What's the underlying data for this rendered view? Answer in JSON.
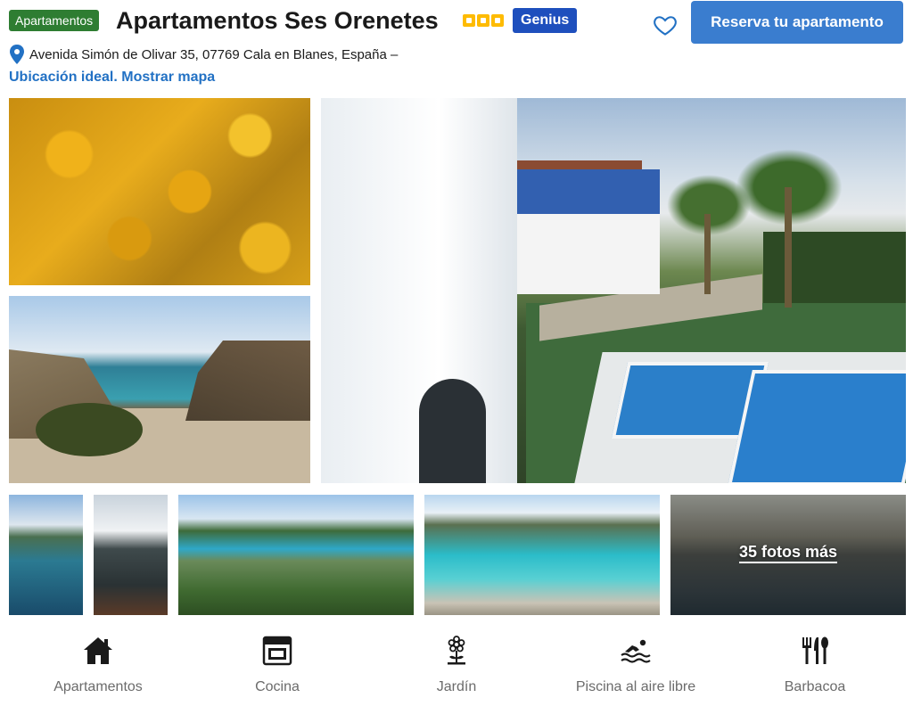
{
  "header": {
    "type_badge": "Apartamentos",
    "title": "Apartamentos Ses Orenetes",
    "star_rating": 3,
    "genius_badge": "Genius",
    "reserve_button": "Reserva tu apartamento"
  },
  "location": {
    "address": "Avenida Simón de Olivar 35, 07769 Cala en Blanes, España –",
    "map_link": "Ubicación ideal. Mostrar mapa"
  },
  "gallery": {
    "more_photos": "35 fotos más"
  },
  "amenities": [
    {
      "icon": "house-icon",
      "label": "Apartamentos"
    },
    {
      "icon": "oven-icon",
      "label": "Cocina"
    },
    {
      "icon": "flower-icon",
      "label": "Jardín"
    },
    {
      "icon": "swimmer-icon",
      "label": "Piscina al aire libre"
    },
    {
      "icon": "cutlery-icon",
      "label": "Barbacoa"
    }
  ],
  "colors": {
    "type_badge": "#2e7d32",
    "genius": "#1e4fbd",
    "primary_button": "#3a7dcf",
    "link": "#2271c4",
    "star": "#febb02"
  }
}
